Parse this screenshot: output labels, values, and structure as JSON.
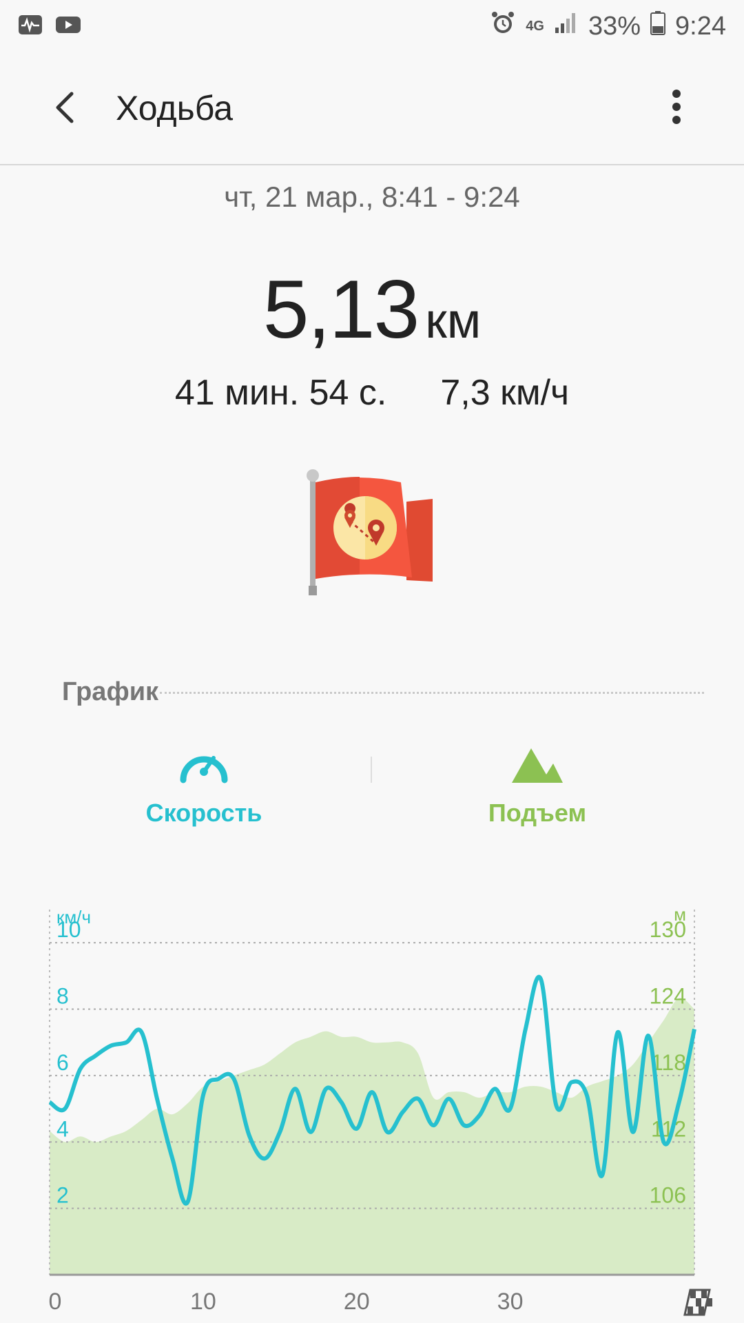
{
  "status_bar": {
    "battery": "33%",
    "time": "9:24",
    "network": "4G",
    "icons": [
      "activity-icon",
      "youtube-icon",
      "alarm-icon",
      "signal-icon",
      "battery-icon"
    ]
  },
  "header": {
    "title": "Ходьба"
  },
  "summary": {
    "date_range": "чт, 21 мар., 8:41 - 9:24",
    "distance_value": "5,13",
    "distance_unit": "км",
    "duration": "41 мин. 54 с.",
    "avg_speed": "7,3 км/ч"
  },
  "section": {
    "label": "График"
  },
  "tabs": {
    "speed_label": "Скорость",
    "elevation_label": "Подъем"
  },
  "colors": {
    "speed": "#26c0cf",
    "elevation": "#8cc152",
    "elevation_fill": "#d8ebc6",
    "badge_red": "#f4563f"
  },
  "chart_data": {
    "type": "line",
    "left_unit": "км/ч",
    "right_unit": "м",
    "left_ticks": [
      "2",
      "4",
      "6",
      "8",
      "10"
    ],
    "right_ticks": [
      "106",
      "112",
      "118",
      "124",
      "130"
    ],
    "x_ticks": [
      "0",
      "10",
      "20",
      "30"
    ],
    "xlim": [
      0,
      42
    ],
    "ylim_left": [
      0,
      11
    ],
    "ylim_right": [
      100,
      133
    ],
    "series": [
      {
        "axis": "left",
        "x": [
          0,
          1,
          2,
          3,
          4,
          5,
          6,
          7,
          8,
          9,
          10,
          11,
          12,
          13,
          14,
          15,
          16,
          17,
          18,
          19,
          20,
          21,
          22,
          23,
          24,
          25,
          26,
          27,
          28,
          29,
          30,
          31,
          32,
          33,
          34,
          35,
          36,
          37,
          38,
          39,
          40,
          41,
          42
        ],
        "values": [
          5.2,
          5.0,
          6.2,
          6.6,
          6.9,
          7.0,
          7.3,
          5.3,
          3.5,
          2.2,
          5.4,
          5.9,
          5.9,
          4.2,
          3.5,
          4.3,
          5.6,
          4.3,
          5.6,
          5.2,
          4.4,
          5.5,
          4.3,
          4.9,
          5.3,
          4.5,
          5.3,
          4.5,
          4.8,
          5.6,
          5.0,
          7.4,
          8.9,
          5.1,
          5.8,
          5.4,
          3.0,
          7.3,
          4.3,
          7.2,
          4.0,
          5.2,
          7.4
        ]
      },
      {
        "axis": "right",
        "x": [
          0,
          1,
          2,
          3,
          4,
          5,
          6,
          7,
          8,
          9,
          10,
          11,
          12,
          13,
          14,
          15,
          16,
          17,
          18,
          19,
          20,
          21,
          22,
          23,
          24,
          25,
          26,
          27,
          28,
          29,
          30,
          31,
          32,
          33,
          34,
          35,
          36,
          37,
          38,
          39,
          40,
          41,
          42
        ],
        "values": [
          113,
          112,
          112.5,
          112,
          112.5,
          113,
          114,
          115,
          114.5,
          115.5,
          117,
          117.5,
          118,
          118.5,
          119,
          120,
          121,
          121.5,
          122,
          121.5,
          121.5,
          121,
          121,
          121,
          120,
          116,
          116.5,
          116.5,
          116,
          116.5,
          116.5,
          117,
          117,
          116.5,
          116,
          117,
          117.5,
          118,
          119,
          121,
          123,
          125,
          124
        ]
      }
    ]
  }
}
